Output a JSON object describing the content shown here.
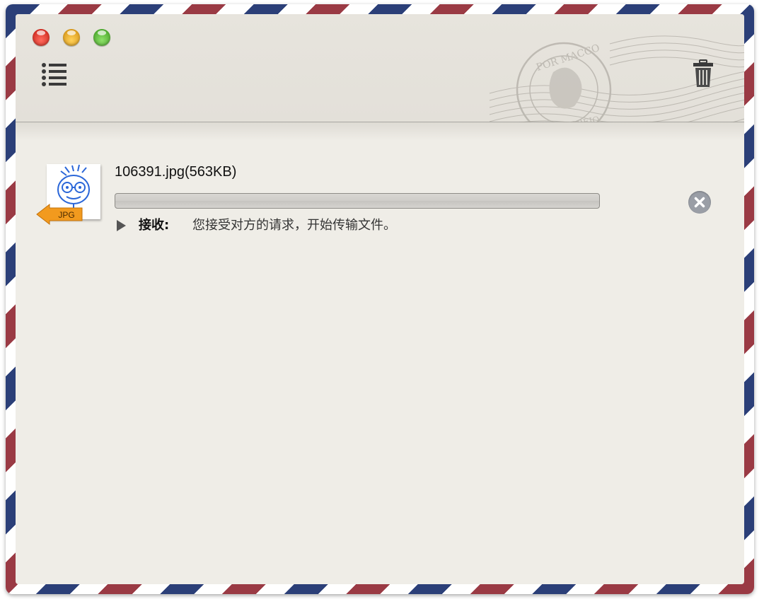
{
  "window": {
    "controls": {
      "close": "close-button",
      "minimize": "minimize-button",
      "zoom": "zoom-button"
    }
  },
  "toolbar": {
    "list_icon": "list-icon",
    "trash_icon": "trash-icon",
    "stamp_text_top": "POR MACCO",
    "stamp_text_bottom": "CORREIO"
  },
  "transfer": {
    "file_name": "106391.jpg(563KB)",
    "file_type_badge": "JPG",
    "progress": 0,
    "status_label": "接收:",
    "status_message": "您接受对方的请求，开始传输文件。"
  },
  "colors": {
    "stripe_blue": "#2b3f78",
    "stripe_red": "#9a3a44",
    "window_bg": "#efede7",
    "badge_orange": "#f29a1e"
  }
}
